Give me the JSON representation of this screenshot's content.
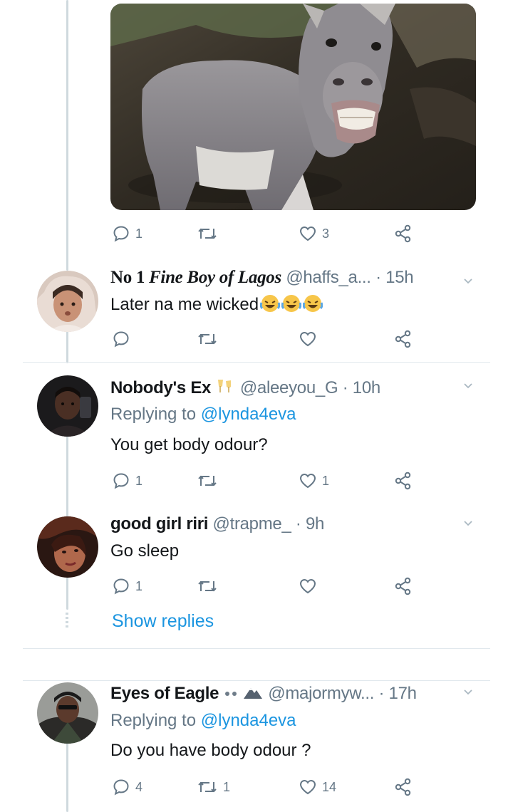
{
  "media": {
    "icon": "donkey-photo"
  },
  "first_tweet": {
    "reply_count": "1",
    "retweet_count": "",
    "like_count": "3"
  },
  "replies": [
    {
      "name_prefix": "No 1",
      "name_italic": "Fine Boy of Lagos",
      "handle": "@haffs_a...",
      "time": "15h",
      "text": "Later na me wicked",
      "emoji": [
        "tears-of-joy-emoji",
        "tears-of-joy-emoji",
        "tears-of-joy-emoji"
      ],
      "reply_count": "",
      "retweet_count": "",
      "like_count": ""
    },
    {
      "name": "Nobody's Ex",
      "handle": "@aleeyou_G",
      "time": "10h",
      "replying_prefix": "Replying to",
      "replying_to": "@lynda4eva",
      "text": "You get body odour?",
      "reply_count": "1",
      "retweet_count": "",
      "like_count": "1"
    },
    {
      "name": "good girl riri",
      "handle": "@trapme_",
      "time": "9h",
      "text": "Go sleep",
      "reply_count": "1",
      "retweet_count": "",
      "like_count": ""
    }
  ],
  "show_replies": "Show replies",
  "bottom_tweet": {
    "name": "Eyes of Eagle",
    "handle": "@majormyw...",
    "time": "17h",
    "replying_prefix": "Replying to",
    "replying_to": "@lynda4eva",
    "text": "Do you have body odour ?",
    "reply_count": "4",
    "retweet_count": "1",
    "like_count": "14"
  },
  "separator": "·",
  "colors": {
    "link": "#1b95e0",
    "muted": "#657786",
    "thread": "#cfd9de"
  }
}
